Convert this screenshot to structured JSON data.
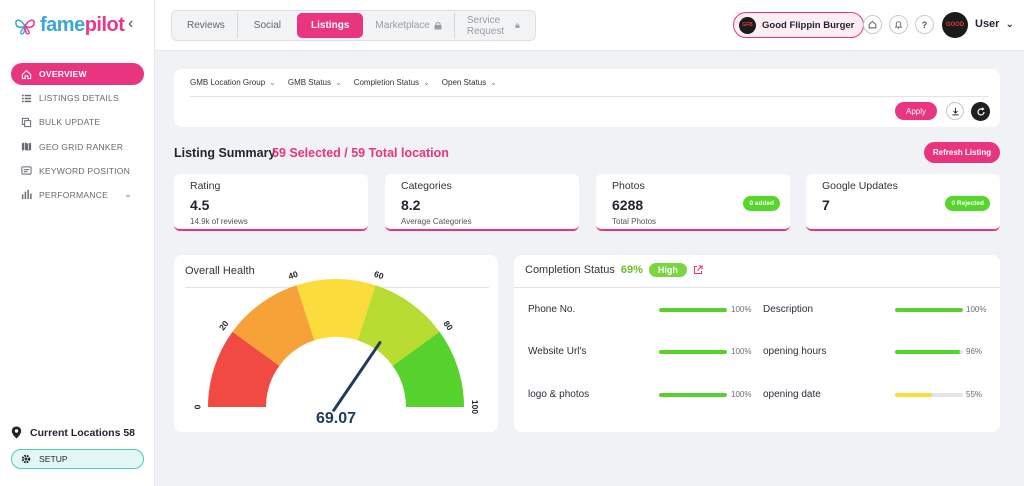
{
  "brand": {
    "logo_a": "fame",
    "logo_b": "pilot"
  },
  "sidebar": {
    "items": [
      {
        "label": "OVERVIEW",
        "icon": "home-icon"
      },
      {
        "label": "LISTINGS DETAILS",
        "icon": "list-icon"
      },
      {
        "label": "BULK UPDATE",
        "icon": "copy-icon"
      },
      {
        "label": "GEO GRID RANKER",
        "icon": "map-icon"
      },
      {
        "label": "KEYWORD POSITION",
        "icon": "keyword-icon"
      },
      {
        "label": "PERFORMANCE",
        "icon": "bar-chart-icon"
      }
    ],
    "current_locations": "Current Locations 58",
    "setup": "SETUP"
  },
  "topbar": {
    "tabs": [
      "Reviews",
      "Social",
      "Listings",
      "Marketplace",
      "Service Request"
    ],
    "business": "Good Flippin Burger",
    "user": "User"
  },
  "filters": {
    "items": [
      "GMB Location Group",
      "GMB Status",
      "Completion Status",
      "Open Status"
    ],
    "apply": "Apply"
  },
  "summary": {
    "title": "Listing Summary",
    "selected": "59 Selected / 59 Total location",
    "refresh": "Refresh Listing"
  },
  "stats": [
    {
      "label": "Rating",
      "value": "4.5",
      "sub": "14.9k of reviews",
      "badge": ""
    },
    {
      "label": "Categories",
      "value": "8.2",
      "sub": "Average Categories",
      "badge": ""
    },
    {
      "label": "Photos",
      "value": "6288",
      "sub": "Total Photos",
      "badge": "0 added"
    },
    {
      "label": "Google Updates",
      "value": "7",
      "sub": "",
      "badge": "0 Rejected"
    }
  ],
  "health": {
    "title": "Overall Health",
    "value": 69.07,
    "value_text": "69.07",
    "ticks": [
      "0",
      "20",
      "40",
      "60",
      "80",
      "100"
    ],
    "colors": [
      "#f04a42",
      "#f7a238",
      "#fadd3c",
      "#b9dc32",
      "#57d12c"
    ]
  },
  "completion": {
    "title": "Completion Status",
    "pct": "69%",
    "level": "High",
    "rows": [
      {
        "label": "Phone No.",
        "pct": "100%",
        "value": 100,
        "color": "#57d12c"
      },
      {
        "label": "Description",
        "pct": "100%",
        "value": 100,
        "color": "#57d12c"
      },
      {
        "label": "Website Url's",
        "pct": "100%",
        "value": 100,
        "color": "#57d12c"
      },
      {
        "label": "opening hours",
        "pct": "96%",
        "value": 96,
        "color": "#57d12c"
      },
      {
        "label": "logo & photos",
        "pct": "100%",
        "value": 100,
        "color": "#57d12c"
      },
      {
        "label": "opening date",
        "pct": "55%",
        "value": 55,
        "color": "#fadd3c"
      }
    ]
  },
  "colors": {
    "accent": "#e9347f",
    "teal": "#4cc9b8",
    "green": "#57d12c"
  }
}
